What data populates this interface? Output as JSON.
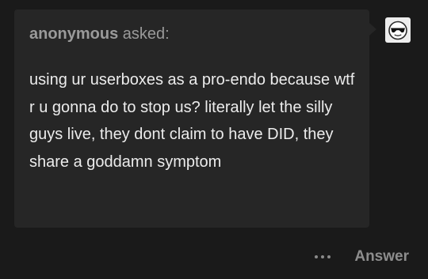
{
  "ask": {
    "asker_name": "anonymous",
    "asked_suffix": " asked:",
    "question": "using ur userboxes as a pro-endo because wtf r u gonna do to stop us? literally let the silly guys live, they dont claim to have DID, they share a goddamn symptom"
  },
  "avatar": {
    "icon": "sunglasses-face-icon"
  },
  "footer": {
    "more_icon": "ellipsis-icon",
    "answer_label": "Answer"
  },
  "colors": {
    "background": "#1a1a1a",
    "bubble": "#262626",
    "question_text": "#ececec",
    "muted_text": "#9a9a9a"
  }
}
